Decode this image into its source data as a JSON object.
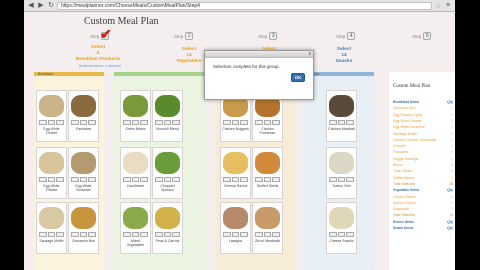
{
  "browser": {
    "url": "https://mealplanner.com/ChooseMeals/CustomMealPlan/Step4",
    "back": "◀",
    "forward": "▶",
    "reload": "↻",
    "star": "☆",
    "menu": "≡"
  },
  "page": {
    "title": "Custom Meal Plan"
  },
  "steps": [
    {
      "label": "Step",
      "num": "1",
      "select": "Select\n4\nBreakfast Products",
      "sub": "Breakfast items: 4 selected",
      "state": "done"
    },
    {
      "label": "Step",
      "num": "2",
      "select": "",
      "sub": "",
      "state": "idle"
    },
    {
      "label": "Step",
      "num": "3",
      "select": "Select\n14\nVegetables",
      "sub": "",
      "state": "done"
    },
    {
      "label": "Step",
      "num": "4",
      "select": "Select",
      "sub": "",
      "state": "idle"
    },
    {
      "label": "Step",
      "num": "5",
      "select": "Select\n14\nSnacks",
      "sub": "",
      "state": "active"
    },
    {
      "label": "Step",
      "num": "6",
      "select": "",
      "sub": "",
      "state": "idle"
    }
  ],
  "columns": [
    {
      "header": "Breakfast",
      "items": [
        "Egg White Omelet",
        "Pancakes",
        "Egg White Frittata",
        "Egg White Scramble",
        "Sausage Muffin",
        "Cinnamon Bun"
      ]
    },
    {
      "header": "Vegetables",
      "items": [
        "Green Beans",
        "Broccoli Blend",
        "Cauliflower",
        "Chopped Spinach",
        "Mixed Vegetables",
        "Peas & Carrots"
      ]
    },
    {
      "header": "Entrees",
      "items": [
        "Chicken Nuggets",
        "Chicken Parmesan",
        "Cheese Ravioli",
        "Stuffed Shells",
        "Lasagna",
        "Ziti w/ Meatballs"
      ]
    },
    {
      "header": "Snacks",
      "items": [
        "Chicken Meatball",
        "Turkey Chili",
        "Cheese Snacks"
      ]
    }
  ],
  "column_headers_small": [
    "Breakfast",
    "",
    "",
    "Snacks"
  ],
  "modal": {
    "message": "Selection complete for this group.",
    "ok": "OK",
    "close": "x"
  },
  "plan": {
    "title": "Custom Meal Plan",
    "sections": [
      {
        "label": "Breakfast Items",
        "qty": "Qty",
        "head": true
      },
      {
        "label": "Cinnamon Bun",
        "qty": "1"
      },
      {
        "label": "Egg Frittata (Light)",
        "qty": "1"
      },
      {
        "label": "Egg White Omelet",
        "qty": "1"
      },
      {
        "label": "Egg White Scramble",
        "qty": "1"
      },
      {
        "label": "Sausage Muffin",
        "qty": "1"
      },
      {
        "label": "Chicken Cheese Quesadilla",
        "qty": "1"
      },
      {
        "label": "Gnocchi",
        "qty": "1"
      },
      {
        "label": "Pancakes",
        "qty": "1"
      },
      {
        "label": "Veggie Sausage",
        "qty": "1"
      },
      {
        "label": "Bacon",
        "qty": "1"
      },
      {
        "label": "Toast Slices",
        "qty": "1"
      },
      {
        "label": "Coffee Beans",
        "qty": "1"
      },
      {
        "label": "Total Selected",
        "qty": "28",
        "total": true
      },
      {
        "label": "Vegetable Items",
        "qty": "Qty",
        "head": true
      },
      {
        "label": "Chicken Blend",
        "qty": "1"
      },
      {
        "label": "Spinach Blend",
        "qty": "1"
      },
      {
        "label": "Edamame",
        "qty": "1"
      },
      {
        "label": "Total Selected",
        "qty": "14",
        "total": true
      },
      {
        "label": "Entree Items",
        "qty": "Qty",
        "head": true
      },
      {
        "label": "Snack Items",
        "qty": "Qty",
        "head": true
      }
    ]
  },
  "colors": {
    "step_done": "#e0a018",
    "step_active": "#3d7fb8",
    "bar_gold": "#e8b84a",
    "bar_green": "#a7d489",
    "bar_blue": "#8fb8dc",
    "plan_item": "#e8a040",
    "plan_head": "#3a72b5"
  }
}
